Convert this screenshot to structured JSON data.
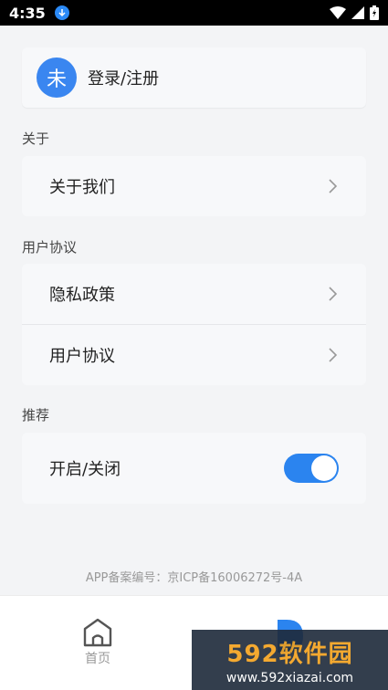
{
  "status_bar": {
    "time": "4:35"
  },
  "login": {
    "avatar_text": "未",
    "label": "登录/注册"
  },
  "sections": {
    "about": {
      "title": "关于",
      "items": [
        {
          "label": "关于我们"
        }
      ]
    },
    "agreement": {
      "title": "用户协议",
      "items": [
        {
          "label": "隐私政策"
        },
        {
          "label": "用户协议"
        }
      ]
    },
    "recommend": {
      "title": "推荐",
      "toggle_label": "开启/关闭",
      "toggle_on": true
    }
  },
  "footer": {
    "icp": "APP备案编号：京ICP备16006272号-4A"
  },
  "bottom_nav": {
    "home_label": "首页"
  },
  "watermark": {
    "main": "592软件园",
    "url": "www.592xiazai.com"
  },
  "colors": {
    "accent": "#2b84ef",
    "avatar": "#3a86f0",
    "background": "#f3f4f6"
  }
}
